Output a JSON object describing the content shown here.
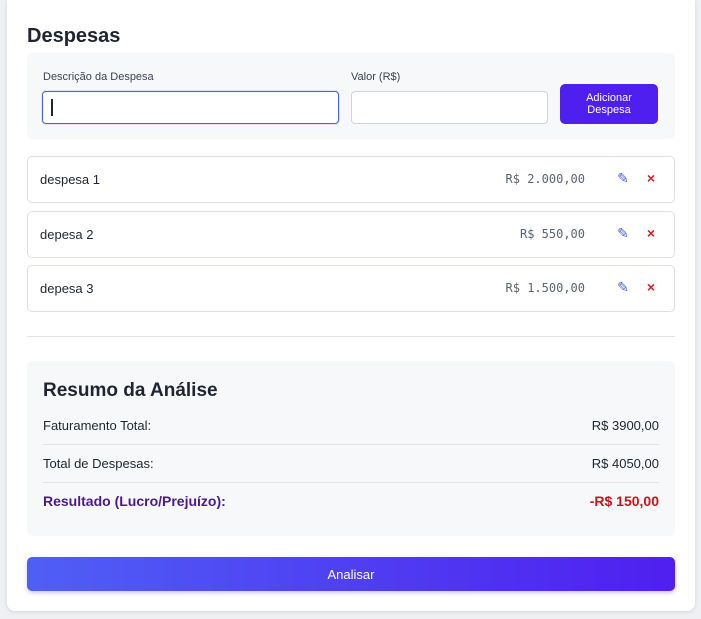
{
  "header": {
    "title": "Despesas"
  },
  "form": {
    "description_label": "Descrição da Despesa",
    "description_value": "",
    "value_label": "Valor (R$)",
    "value_value": "",
    "add_button_label": "Adicionar Despesa"
  },
  "expenses": [
    {
      "name": "despesa 1",
      "value": "R$ 2.000,00"
    },
    {
      "name": "depesa 2",
      "value": "R$ 550,00"
    },
    {
      "name": "depesa 3",
      "value": "R$ 1.500,00"
    }
  ],
  "icons": {
    "edit": "pencil-icon",
    "delete": "close-icon"
  },
  "summary": {
    "title": "Resumo da Análise",
    "revenue_label": "Faturamento Total:",
    "revenue_value": "R$ 3900,00",
    "expenses_label": "Total de Despesas:",
    "expenses_value": "R$ 4050,00",
    "result_label": "Resultado (Lucro/Prejuízo):",
    "result_value": "-R$ 150,00"
  },
  "actions": {
    "analyze_label": "Analisar"
  },
  "colors": {
    "accent": "#4f1ff0",
    "edit": "#4a63d8",
    "delete": "#d21f2b",
    "result_label": "#4a1a8c",
    "negative": "#c4161c"
  }
}
